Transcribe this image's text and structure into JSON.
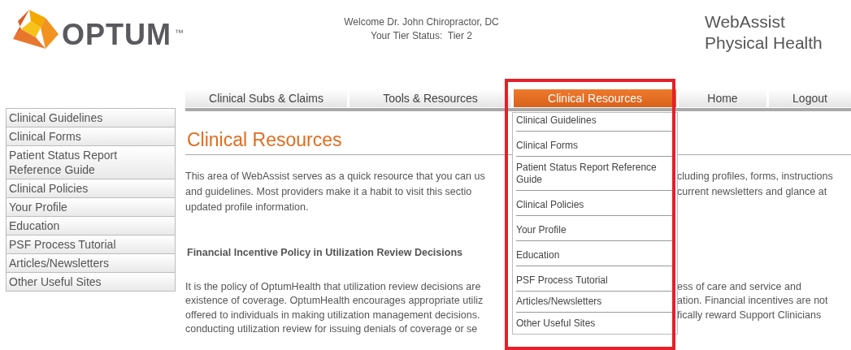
{
  "header": {
    "logo_text": "OPTUM",
    "trademark": "™",
    "welcome": "Welcome Dr.  John Chiropractor, DC",
    "tier_label": "Your Tier Status:",
    "tier_value": "Tier 2",
    "app_title_line1": "WebAssist",
    "app_title_line2": "Physical Health"
  },
  "nav": [
    {
      "label": "Clinical Subs & Claims",
      "selected": false
    },
    {
      "label": "Tools & Resources",
      "selected": false
    },
    {
      "label": "Clinical Resources",
      "selected": true
    },
    {
      "label": "Home",
      "selected": false
    },
    {
      "label": "Logout",
      "selected": false
    }
  ],
  "sidebar": {
    "items": [
      "Clinical Guidelines",
      "Clinical Forms",
      "Patient Status Report Reference Guide",
      "Clinical Policies",
      "Your Profile",
      "Education",
      "PSF Process Tutorial",
      "Articles/Newsletters",
      "Other Useful Sites"
    ]
  },
  "content": {
    "title": "Clinical Resources",
    "intro_lines": [
      {
        "left": "This area of WebAssist serves as a quick resource that you can us",
        "right": "cluding profiles, forms, instructions"
      },
      {
        "left": "and guidelines.  Most providers make it a habit to visit this sectio",
        "right": "current newsletters and glance at"
      },
      {
        "left": "updated profile information."
      }
    ],
    "section_heading": "Financial Incentive Policy in Utilization Review Decisions",
    "policy_lines": [
      {
        "left": "It is the policy of OptumHealth that utilization review decisions are",
        "right": "ess of care and service and"
      },
      {
        "left": "existence of coverage. OptumHealth encourages appropriate utiliz",
        "right": "ation. Financial incentives are not"
      },
      {
        "left": "offered to individuals in making utilization management decisions.",
        "right": "fically reward Support Clinicians"
      },
      {
        "left": "conducting utilization review for issuing denials of coverage or se"
      }
    ]
  },
  "dropdown": {
    "items": [
      "Clinical Guidelines",
      "Clinical Forms",
      "Patient Status Report Reference Guide",
      "Clinical Policies",
      "Your Profile",
      "Education",
      "PSF Process Tutorial",
      "Articles/Newsletters",
      "Other Useful Sites"
    ]
  }
}
